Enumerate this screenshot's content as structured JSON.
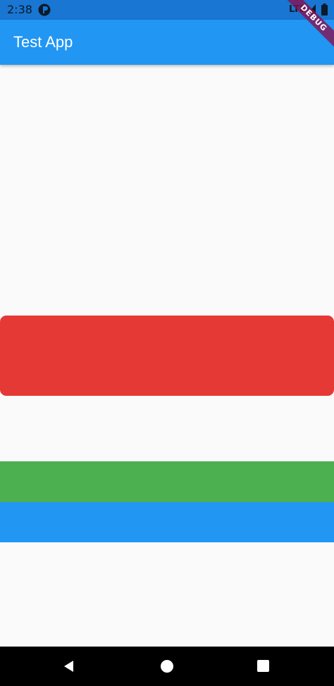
{
  "status_bar": {
    "time": "2:38",
    "network": "LTE",
    "icons": [
      "app-notification-icon",
      "signal-icon",
      "battery-icon"
    ]
  },
  "app_bar": {
    "title": "Test App"
  },
  "debug_banner": {
    "label": "DEBUG"
  },
  "nav_bar": {
    "icons": [
      "back-icon",
      "home-icon",
      "recents-icon"
    ]
  },
  "colors": {
    "status_bar": "#1976d2",
    "app_bar": "#2196f3",
    "background": "#fafafa",
    "red_box": "#e53935",
    "green_strip": "#4caf50",
    "blue_strip": "#2196f3",
    "debug_banner": "#880e4f",
    "nav_bar": "#000000"
  }
}
